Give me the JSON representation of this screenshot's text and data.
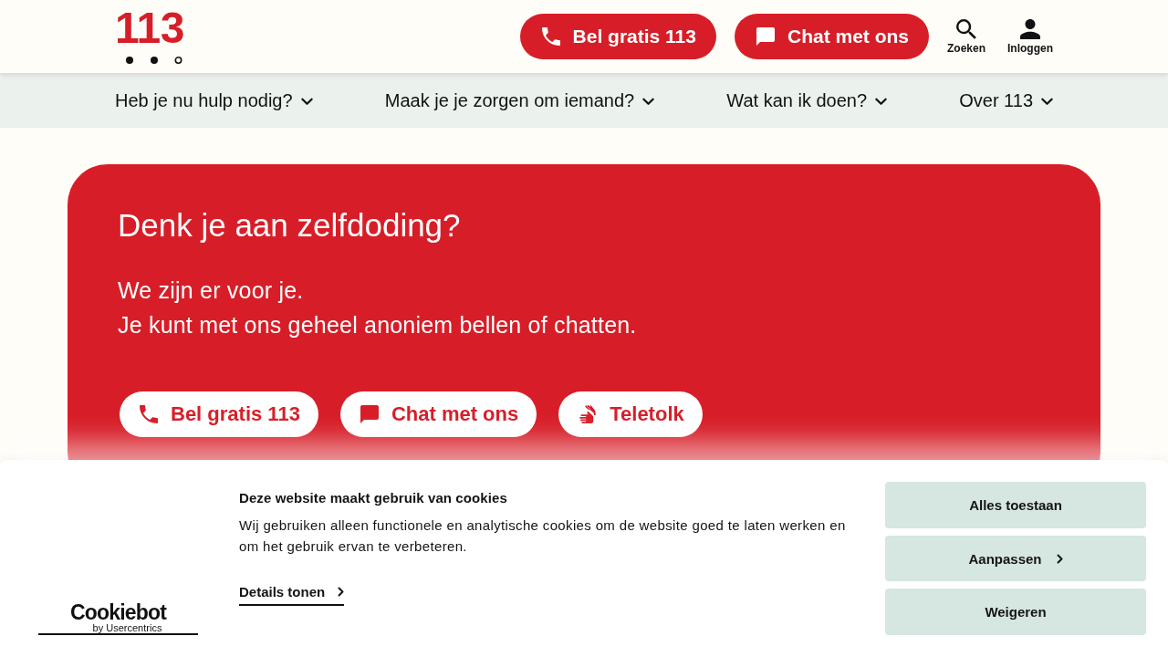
{
  "header": {
    "logo": "113",
    "actions": [
      {
        "kind": "call",
        "label": "Bel gratis 113"
      },
      {
        "kind": "chat",
        "label": "Chat met ons"
      }
    ],
    "tools": [
      {
        "kind": "search",
        "label": "Zoeken"
      },
      {
        "kind": "user",
        "label": "Inloggen"
      }
    ]
  },
  "nav": {
    "items": [
      {
        "label": "Heb je nu hulp nodig?"
      },
      {
        "label": "Maak je je zorgen om iemand?"
      },
      {
        "label": "Wat kan ik doen?"
      },
      {
        "label": "Over 113"
      }
    ]
  },
  "hero": {
    "title": "Denk je aan zelfdoding?",
    "lines": [
      "We zijn er voor je.",
      "Je kunt met ons geheel anoniem bellen of chatten."
    ],
    "buttons": [
      {
        "kind": "call",
        "label": "Bel gratis 113"
      },
      {
        "kind": "chat",
        "label": "Chat met ons"
      },
      {
        "kind": "sign",
        "label": "Teletolk"
      }
    ]
  },
  "cookie_banner": {
    "brand": {
      "name": "Cookiebot",
      "byline": "by Usercentrics"
    },
    "title": "Deze website maakt gebruik van cookies",
    "text": "Wij gebruiken alleen functionele en analytische cookies om de website goed te laten werken en om het gebruik ervan te verbeteren.",
    "details_link": "Details tonen",
    "buttons": [
      {
        "kind": "plain",
        "label": "Alles toestaan"
      },
      {
        "kind": "more",
        "label": "Aanpassen"
      },
      {
        "kind": "plain",
        "label": "Weigeren"
      }
    ]
  }
}
